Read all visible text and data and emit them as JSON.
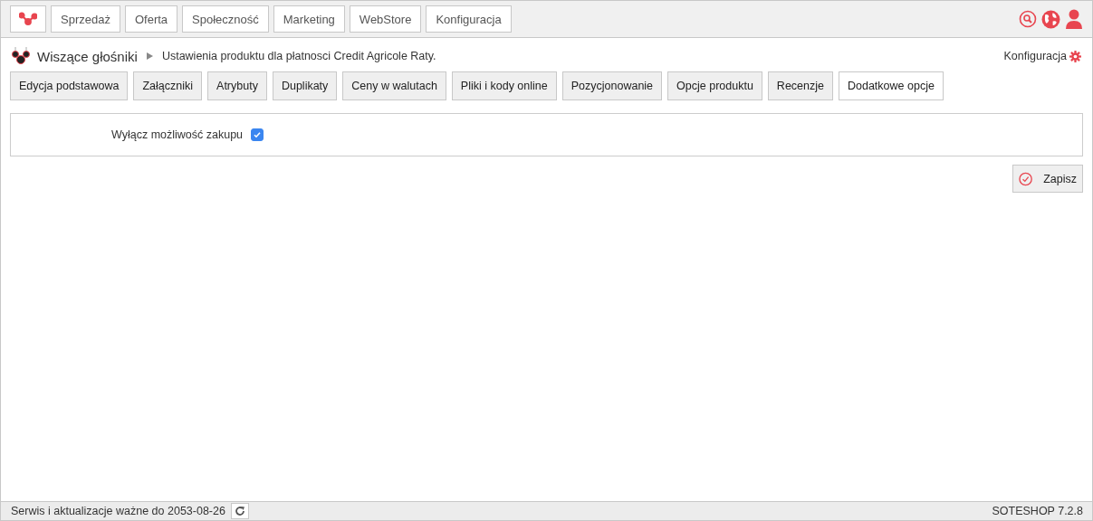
{
  "top_menu": [
    {
      "label": "Sprzedaż"
    },
    {
      "label": "Oferta"
    },
    {
      "label": "Społeczność"
    },
    {
      "label": "Marketing"
    },
    {
      "label": "WebStore"
    },
    {
      "label": "Konfiguracja"
    }
  ],
  "breadcrumb": {
    "product": "Wiszące głośniki",
    "page": "Ustawienia produktu dla płatnosci Credit Agricole Raty."
  },
  "config_link": "Konfiguracja",
  "tabs": [
    {
      "label": "Edycja podstawowa",
      "selected": false
    },
    {
      "label": "Załączniki",
      "selected": false
    },
    {
      "label": "Atrybuty",
      "selected": false
    },
    {
      "label": "Duplikaty",
      "selected": false
    },
    {
      "label": "Ceny w walutach",
      "selected": false
    },
    {
      "label": "Pliki i kody online",
      "selected": false
    },
    {
      "label": "Pozycjonowanie",
      "selected": false
    },
    {
      "label": "Opcje produktu",
      "selected": false
    },
    {
      "label": "Recenzje",
      "selected": false
    },
    {
      "label": "Dodatkowe opcje",
      "selected": true
    }
  ],
  "form": {
    "fields": [
      {
        "label": "Wyłącz możliwość zakupu",
        "checked": true
      }
    ]
  },
  "save_button": "Zapisz",
  "status_bar": {
    "license": "Serwis i aktualizacje ważne do 2053-08-26",
    "version": "SOTESHOP 7.2.8"
  }
}
